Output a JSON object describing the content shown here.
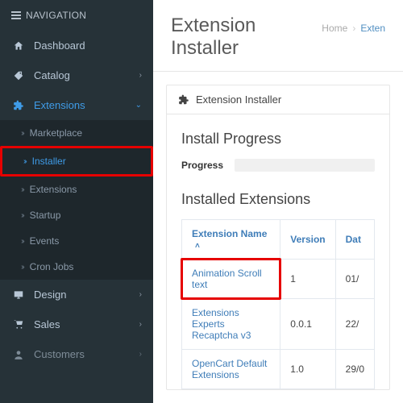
{
  "sidebar": {
    "header": "NAVIGATION",
    "items": [
      {
        "icon": "dashboard",
        "label": "Dashboard",
        "expandable": false
      },
      {
        "icon": "catalog",
        "label": "Catalog",
        "expandable": true
      },
      {
        "icon": "extensions",
        "label": "Extensions",
        "expandable": true,
        "active": true,
        "children": [
          {
            "label": "Marketplace"
          },
          {
            "label": "Installer",
            "active": true
          },
          {
            "label": "Extensions"
          },
          {
            "label": "Startup"
          },
          {
            "label": "Events"
          },
          {
            "label": "Cron Jobs"
          }
        ]
      },
      {
        "icon": "design",
        "label": "Design",
        "expandable": true
      },
      {
        "icon": "sales",
        "label": "Sales",
        "expandable": true
      },
      {
        "icon": "customers",
        "label": "Customers",
        "expandable": true
      }
    ]
  },
  "page": {
    "title": "Extension Installer",
    "breadcrumb": {
      "home": "Home",
      "current": "Exten"
    }
  },
  "panel": {
    "head": "Extension Installer",
    "progress_title": "Install Progress",
    "progress_label": "Progress",
    "installed_title": "Installed Extensions",
    "columns": {
      "name": "Extension Name",
      "version": "Version",
      "date": "Dat"
    },
    "rows": [
      {
        "name": "Animation Scroll text",
        "version": "1",
        "date": "01/",
        "highlight": true
      },
      {
        "name": "Extensions Experts Recaptcha v3",
        "version": "0.0.1",
        "date": "22/"
      },
      {
        "name": "OpenCart Default Extensions",
        "version": "1.0",
        "date": "29/0"
      }
    ]
  }
}
